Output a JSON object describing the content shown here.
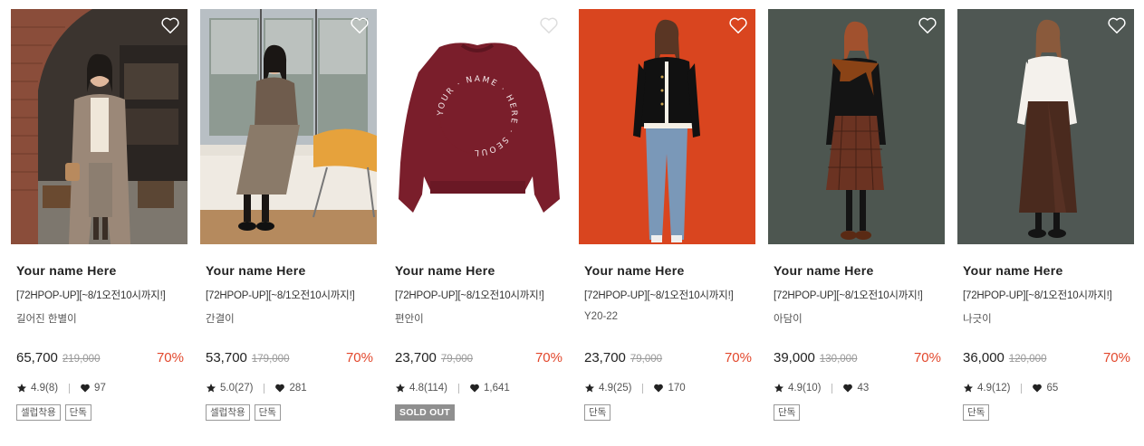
{
  "products": [
    {
      "brand": "Your name Here",
      "promo": "[72HPOP-UP][~8/1오전10시까지!]",
      "seller": "길어진 한별이",
      "price": "65,700",
      "original_price": "219,000",
      "discount": "70%",
      "rating": "4.9(8)",
      "likes": "97",
      "tags": [
        "셀럽착용",
        "단독"
      ],
      "image": "woman-in-beige-coat-photo",
      "wishlist_icon_color": "#ffffff"
    },
    {
      "brand": "Your name Here",
      "promo": "[72HPOP-UP][~8/1오전10시까지!]",
      "seller": "간결이",
      "price": "53,700",
      "original_price": "179,000",
      "discount": "70%",
      "rating": "5.0(27)",
      "likes": "281",
      "tags": [
        "셀럽착용",
        "단독"
      ],
      "image": "woman-sitting-by-window-photo",
      "wishlist_icon_color": "#ffffff"
    },
    {
      "brand": "Your name Here",
      "promo": "[72HPOP-UP][~8/1오전10시까지!]",
      "seller": "편안이",
      "price": "23,700",
      "original_price": "79,000",
      "discount": "70%",
      "rating": "4.8(114)",
      "likes": "1,641",
      "tags": [
        "SOLD OUT"
      ],
      "image": "burgundy-sweatshirt-photo",
      "print_text": "YOUR · NAME · HERE · SEOUL",
      "wishlist_icon_color": "#dddddd"
    },
    {
      "brand": "Your name Here",
      "promo": "[72HPOP-UP][~8/1오전10시까지!]",
      "seller": "Y20-22",
      "price": "23,700",
      "original_price": "79,000",
      "discount": "70%",
      "rating": "4.9(25)",
      "likes": "170",
      "tags": [
        "단독"
      ],
      "image": "woman-orange-background-photo",
      "wishlist_icon_color": "#ffffff"
    },
    {
      "brand": "Your name Here",
      "promo": "[72HPOP-UP][~8/1오전10시까지!]",
      "seller": "아담이",
      "price": "39,000",
      "original_price": "130,000",
      "discount": "70%",
      "rating": "4.9(10)",
      "likes": "43",
      "tags": [
        "단독"
      ],
      "image": "woman-plaid-skirt-photo",
      "wishlist_icon_color": "#ffffff"
    },
    {
      "brand": "Your name Here",
      "promo": "[72HPOP-UP][~8/1오전10시까지!]",
      "seller": "나긋이",
      "price": "36,000",
      "original_price": "120,000",
      "discount": "70%",
      "rating": "4.9(12)",
      "likes": "65",
      "tags": [
        "단독"
      ],
      "image": "woman-brown-skirt-photo",
      "wishlist_icon_color": "#ffffff"
    }
  ],
  "colors": {
    "discount": "#e2472c",
    "price": "#222222",
    "original_price": "#999999",
    "soldout_bg": "#8f8f8f"
  },
  "icons": {
    "wishlist": "heart-outline-icon",
    "rating": "star-icon",
    "likes": "heart-filled-icon"
  }
}
